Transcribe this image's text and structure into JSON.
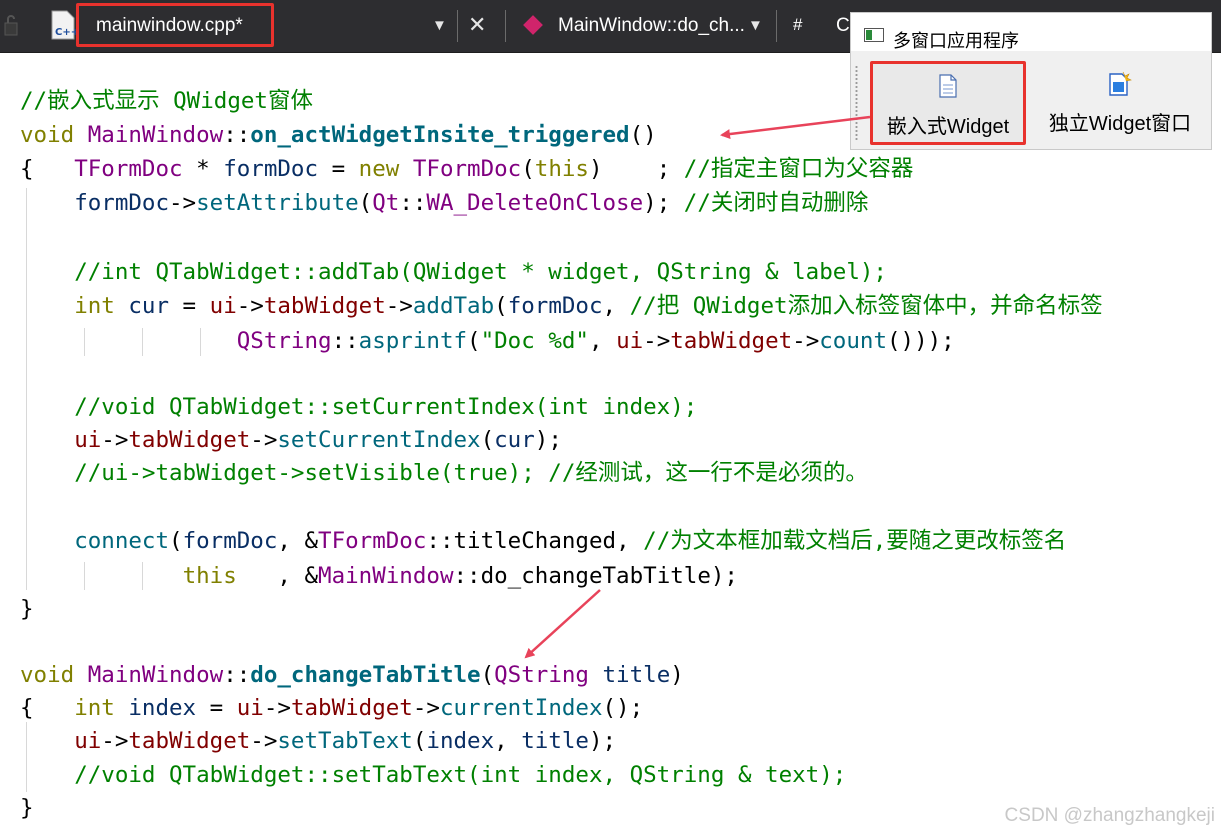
{
  "editor": {
    "file_tab": "mainwindow.cpp*",
    "file_icon_label": "C++",
    "method_dropdown": "MainWindow::do_ch...",
    "hash_label": "#",
    "c_label": "C",
    "dropdown_arrow": "▼",
    "close_glyph": "✕"
  },
  "app_window": {
    "title": "多窗口应用程序",
    "buttons": [
      {
        "label": "嵌入式Widget",
        "icon": "document-icon"
      },
      {
        "label": "独立Widget窗口",
        "icon": "new-document-icon"
      }
    ]
  },
  "code": {
    "l1": "//嵌入式显示 QWidget窗体",
    "l2_kw": "void",
    "l2_cls": "MainWindow",
    "l2_sep": "::",
    "l2_fn": "on_actWidgetInsite_triggered",
    "l2_paren": "()",
    "l3_brace": "{",
    "l3_type": "TFormDoc",
    "l3_star": " * ",
    "l3_var": "formDoc",
    "l3_eq": " = ",
    "l3_new": "new",
    "l3_type2": "TFormDoc",
    "l3_open": "(",
    "l3_this": "this",
    "l3_close": ")    ; ",
    "l3_comment": "//指定主窗口为父容器",
    "l4_var": "formDoc",
    "l4_arrow": "->",
    "l4_fn": "setAttribute",
    "l4_open": "(",
    "l4_ns": "Qt",
    "l4_sep": "::",
    "l4_enum": "WA_DeleteOnClose",
    "l4_close": "); ",
    "l4_comment": "//关闭时自动删除",
    "l6": "//int QTabWidget::addTab(QWidget * widget, QString & label);",
    "l7_kw": "int",
    "l7_var": "cur",
    "l7_eq": " = ",
    "l7_ui": "ui",
    "l7_arrow1": "->",
    "l7_tw": "tabWidget",
    "l7_arrow2": "->",
    "l7_fn": "addTab",
    "l7_open": "(",
    "l7_var2": "formDoc",
    "l7_comma": ", ",
    "l7_comment": "//把 QWidget添加入标签窗体中，并命名标签",
    "l8_type": "QString",
    "l8_sep": "::",
    "l8_fn": "asprintf",
    "l8_open": "(",
    "l8_str": "\"Doc %d\"",
    "l8_comma": ", ",
    "l8_ui": "ui",
    "l8_arrow1": "->",
    "l8_tw": "tabWidget",
    "l8_arrow2": "->",
    "l8_fn2": "count",
    "l8_close": "()));",
    "l10": "//void QTabWidget::setCurrentIndex(int index);",
    "l11_ui": "ui",
    "l11_arrow1": "->",
    "l11_tw": "tabWidget",
    "l11_arrow2": "->",
    "l11_fn": "setCurrentIndex",
    "l11_open": "(",
    "l11_var": "cur",
    "l11_close": ");",
    "l12": "//ui->tabWidget->setVisible(true); //经测试，这一行不是必须的。",
    "l14_fn": "connect",
    "l14_open": "(",
    "l14_var": "formDoc",
    "l14_comma": ", &",
    "l14_type": "TFormDoc",
    "l14_sep": "::",
    "l14_sig": "titleChanged",
    "l14_comma2": ", ",
    "l14_comment": "//为文本框加载文档后,要随之更改标签名",
    "l15_this": "this",
    "l15_comma": "   , &",
    "l15_cls": "MainWindow",
    "l15_sep": "::",
    "l15_slot": "do_changeTabTitle",
    "l15_close": ");",
    "l16_brace": "}",
    "l18_kw": "void",
    "l18_cls": "MainWindow",
    "l18_sep": "::",
    "l18_fn": "do_changeTabTitle",
    "l18_open": "(",
    "l18_type": "QString",
    "l18_param": "title",
    "l18_close": ")",
    "l19_brace": "{",
    "l19_kw": "int",
    "l19_var": "index",
    "l19_eq": " = ",
    "l19_ui": "ui",
    "l19_arrow1": "->",
    "l19_tw": "tabWidget",
    "l19_arrow2": "->",
    "l19_fn": "currentIndex",
    "l19_close": "();",
    "l20_ui": "ui",
    "l20_arrow1": "->",
    "l20_tw": "tabWidget",
    "l20_arrow2": "->",
    "l20_fn": "setTabText",
    "l20_open": "(",
    "l20_var": "index",
    "l20_comma": ", ",
    "l20_param": "title",
    "l20_close": ");",
    "l21": "//void QTabWidget::setTabText(int index, QString & text);",
    "l22_brace": "}"
  },
  "watermark": "CSDN @zhangzhangkeji",
  "colors": {
    "highlight_box": "#e8322d",
    "arrow": "#e8435a",
    "comment": "#008000",
    "keyword": "#808000",
    "function": "#00677c"
  }
}
